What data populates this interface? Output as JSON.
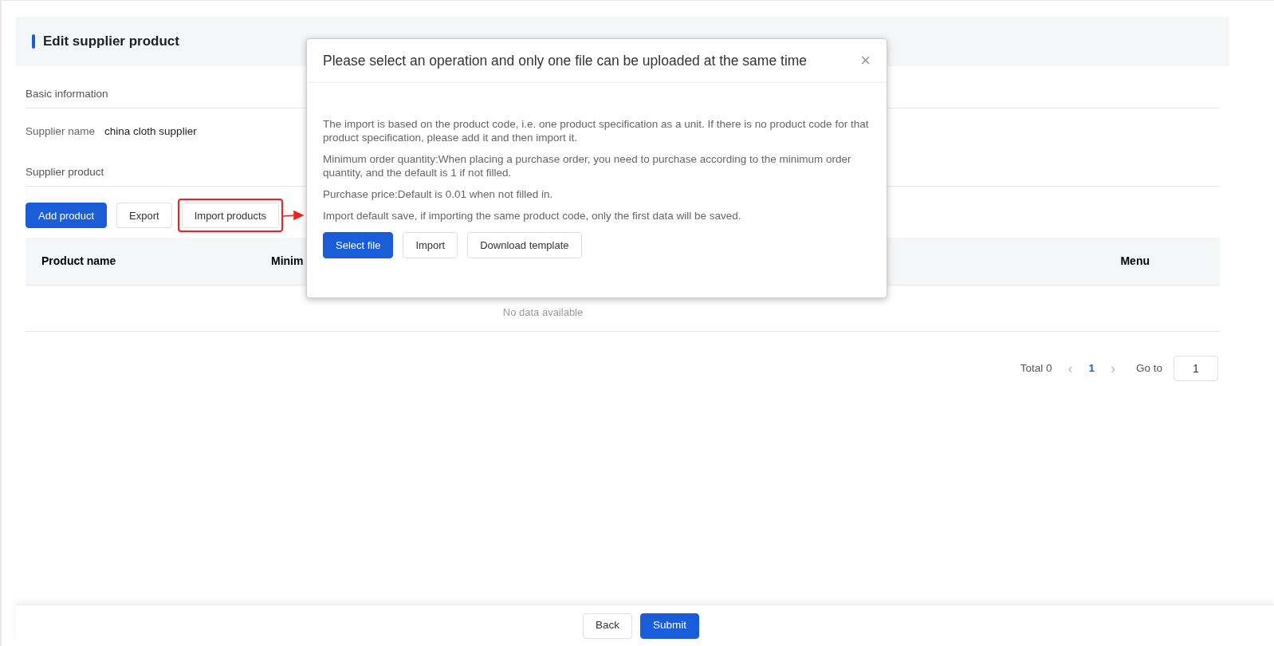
{
  "page": {
    "title": "Edit supplier product"
  },
  "basic_section": {
    "heading": "Basic information",
    "supplier_label": "Supplier name",
    "supplier_value": "china cloth supplier"
  },
  "product_section": {
    "heading": "Supplier product",
    "buttons": [
      {
        "label": "Add product",
        "kind": "primary"
      },
      {
        "label": "Export",
        "kind": "default"
      },
      {
        "label": "Import products",
        "kind": "default",
        "highlighted": true
      }
    ]
  },
  "table": {
    "columns": [
      {
        "label": "Product name"
      },
      {
        "label": "Minim"
      },
      {
        "label": "Menu"
      }
    ],
    "empty_text": "No data available"
  },
  "pagination": {
    "total": "Total 0",
    "prev": "‹",
    "pages": [
      {
        "label": "1",
        "selected": true
      }
    ],
    "next": "›",
    "goto_label": "Go to",
    "goto_value": "1"
  },
  "dialog": {
    "title": "Please select an operation and only one file can be uploaded at the same time",
    "close": "×",
    "paragraphs": [
      "The import is based on the product code, i.e. one product specification as a unit. If there is no product code for that product specification, please add it and then import it.",
      "Minimum order quantity:When placing a purchase order, you need to purchase according to the minimum order quantity, and the default is 1 if not filled.",
      "Purchase price:Default is 0.01 when not filled in.",
      "Import default save, if importing the same product code, only the first data will be saved."
    ],
    "buttons": [
      {
        "label": "Select file",
        "kind": "primary"
      },
      {
        "label": "Import",
        "kind": "default"
      },
      {
        "label": "Download template",
        "kind": "default"
      }
    ]
  },
  "footer": {
    "buttons": [
      {
        "label": "Back",
        "kind": "default"
      },
      {
        "label": "Submit",
        "kind": "primary"
      }
    ]
  }
}
